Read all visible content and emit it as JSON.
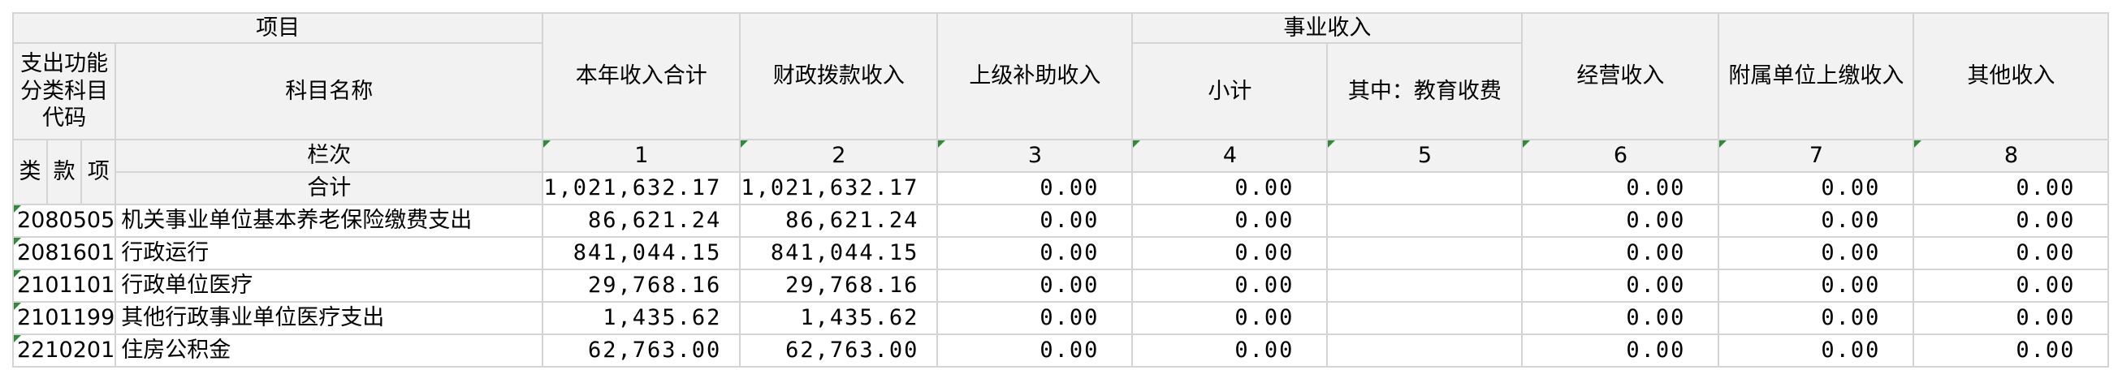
{
  "header": {
    "item": "项目",
    "func_code": "支出功能分类科目代码",
    "subject_name": "科目名称",
    "total_income": "本年收入合计",
    "fiscal": "财政拨款收入",
    "superior": "上级补助收入",
    "business": "事业收入",
    "subtotal": "小计",
    "education": "其中：教育收费",
    "operating": "经营收入",
    "affiliated": "附属单位上缴收入",
    "other": "其他收入",
    "column_no": "栏次",
    "class": "类",
    "section": "款",
    "item_short": "项",
    "total_label": "合计"
  },
  "column_numbers": [
    "1",
    "2",
    "3",
    "4",
    "5",
    "6",
    "7",
    "8"
  ],
  "total": [
    "1,021,632.17",
    "1,021,632.17",
    "0.00",
    "0.00",
    "",
    "0.00",
    "0.00",
    "0.00"
  ],
  "rows": [
    {
      "code": "2080505",
      "name": "机关事业单位基本养老保险缴费支出",
      "values": [
        "86,621.24",
        "86,621.24",
        "0.00",
        "0.00",
        "",
        "0.00",
        "0.00",
        "0.00"
      ]
    },
    {
      "code": "2081601",
      "name": "行政运行",
      "values": [
        "841,044.15",
        "841,044.15",
        "0.00",
        "0.00",
        "",
        "0.00",
        "0.00",
        "0.00"
      ]
    },
    {
      "code": "2101101",
      "name": "行政单位医疗",
      "values": [
        "29,768.16",
        "29,768.16",
        "0.00",
        "0.00",
        "",
        "0.00",
        "0.00",
        "0.00"
      ]
    },
    {
      "code": "2101199",
      "name": "其他行政事业单位医疗支出",
      "values": [
        "1,435.62",
        "1,435.62",
        "0.00",
        "0.00",
        "",
        "0.00",
        "0.00",
        "0.00"
      ]
    },
    {
      "code": "2210201",
      "name": "住房公积金",
      "values": [
        "62,763.00",
        "62,763.00",
        "0.00",
        "0.00",
        "",
        "0.00",
        "0.00",
        "0.00"
      ]
    }
  ]
}
